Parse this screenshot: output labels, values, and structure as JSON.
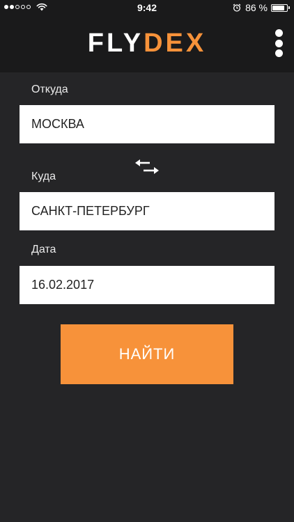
{
  "status_bar": {
    "time": "9:42",
    "battery_percent": "86 %",
    "battery_level": 0.86,
    "signal_bars_filled": 2,
    "signal_bars_total": 5,
    "icons": [
      "wifi-icon",
      "alarm-icon",
      "battery-icon"
    ]
  },
  "header": {
    "logo_part1": "FLY",
    "logo_part2": "DEX",
    "menu_icon": "more-vertical-icon"
  },
  "form": {
    "from_label": "Откуда",
    "from_value": "МОСКВА",
    "to_label": "Куда",
    "to_value": "САНКТ-ПЕТЕРБУРГ",
    "date_label": "Дата",
    "date_value": "16.02.2017",
    "swap_icon": "swap-arrows-icon",
    "search_label": "НАЙТИ"
  },
  "colors": {
    "accent": "#f7923a",
    "background": "#252527",
    "header_background": "#1a1a1b",
    "field_background": "#ffffff"
  }
}
